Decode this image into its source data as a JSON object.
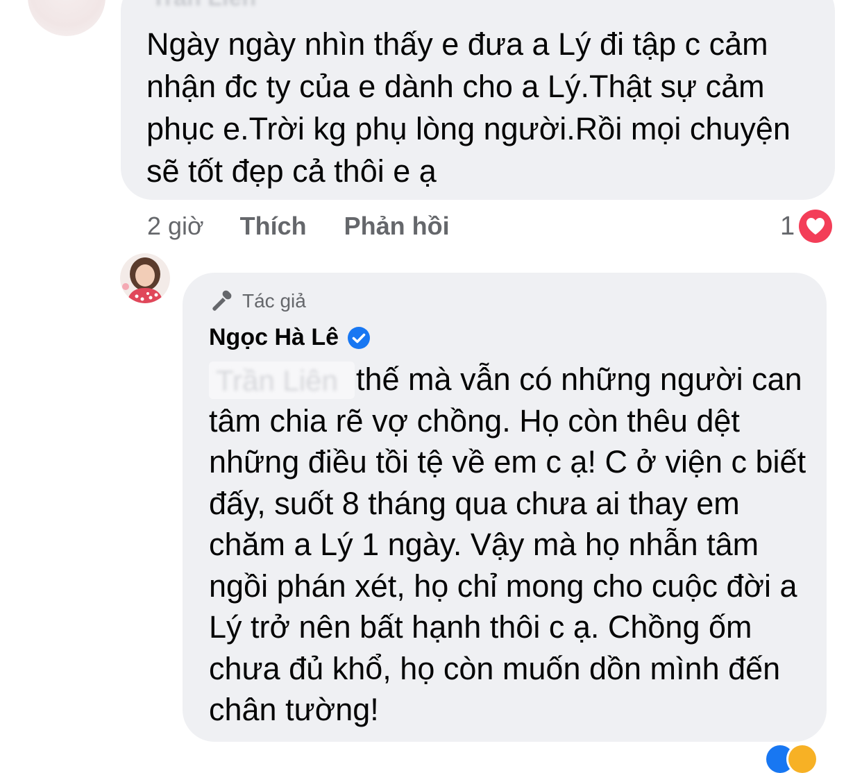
{
  "first_comment": {
    "author_name": "Trần Liên",
    "text": "Ngày ngày nhìn thấy e đưa a Lý đi tập c cảm nhận đc ty của e dành cho a Lý.Thật sự cảm phục e.Trời kg phụ lòng người.Rồi mọi chuyện sẽ tốt đẹp cả thôi e ạ",
    "time": "2 giờ",
    "like_label": "Thích",
    "reply_label": "Phản hồi",
    "reaction_count": "1",
    "reaction_icon": "heart-icon",
    "reaction_color": "#f33e58"
  },
  "reply": {
    "author_tag": "Tác giả",
    "author_name": "Ngọc Hà Lê",
    "verified": true,
    "verified_color": "#1877f2",
    "mention": "Trần Liên",
    "text": "thế mà vẫn có những người can tâm chia rẽ vợ chồng. Họ còn thêu dệt những điều tồi tệ về em c ạ! C ở viện c biết đấy, suốt 8 tháng qua chưa ai thay em chăm a Lý 1 ngày. Vậy mà họ nhẫn tâm ngồi phán xét, họ chỉ mong cho cuộc đời a Lý trở nên bất hạnh thôi c ạ. Chồng ốm chưa đủ khổ, họ còn muốn dồn mình đến chân tường!"
  },
  "colors": {
    "bubble_background": "#eff0f3",
    "secondary_text": "#65676b",
    "primary_text": "#050505"
  }
}
